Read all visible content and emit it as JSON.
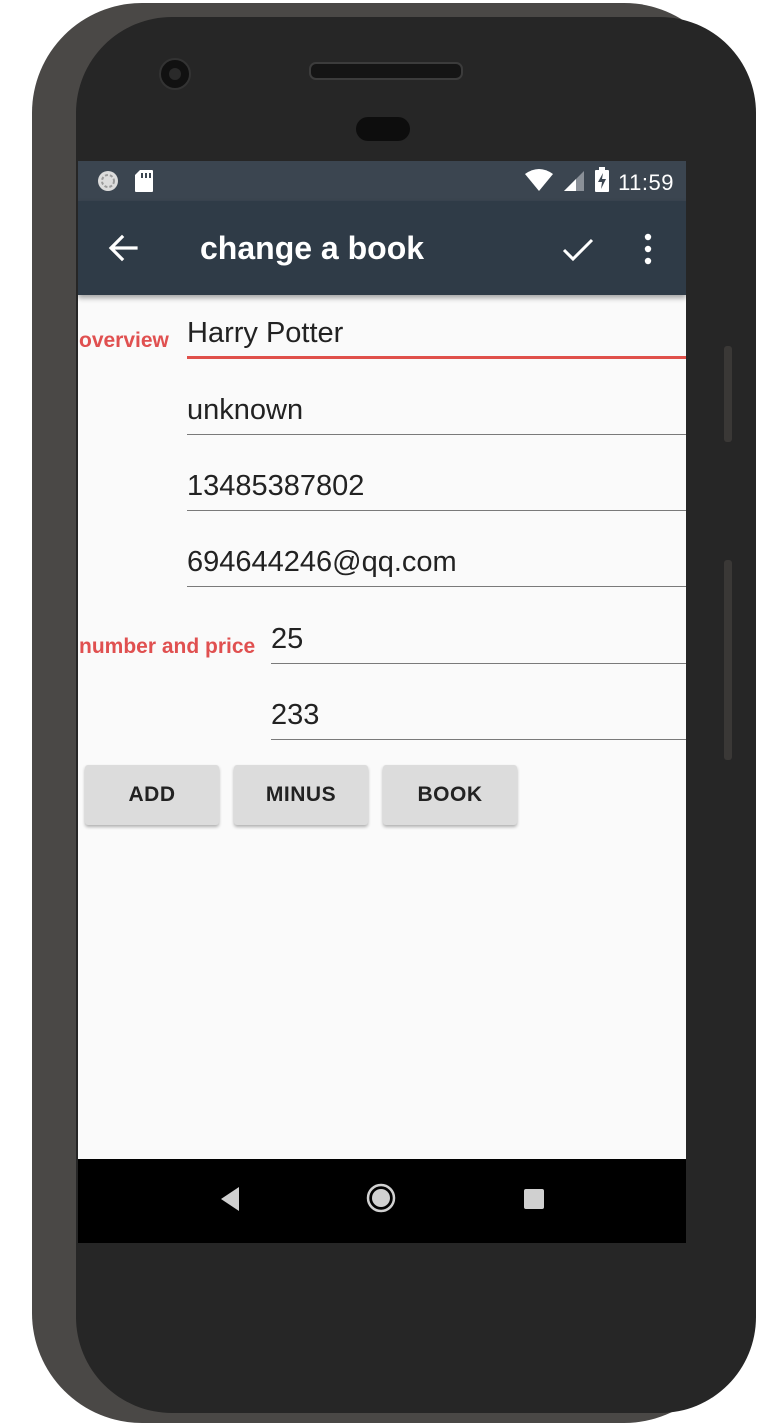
{
  "statusbar": {
    "time": "11:59",
    "icons": [
      "sync-icon",
      "sd-card-icon",
      "wifi-icon",
      "cell-signal-icon",
      "battery-charging-icon"
    ]
  },
  "toolbar": {
    "title": "change a book",
    "back_icon": "arrow-back-icon",
    "confirm_icon": "check-icon",
    "menu_icon": "more-vert-icon"
  },
  "form": {
    "overview_label": "overview",
    "title_value": "Harry Potter",
    "author_value": "unknown",
    "phone_value": "13485387802",
    "email_value": "694644246@qq.com",
    "number_price_label": "number and price",
    "number_value": "25",
    "price_value": "233"
  },
  "buttons": {
    "add": "ADD",
    "minus": "MINUS",
    "book": "BOOK"
  },
  "colors": {
    "accent": "#e05050",
    "toolbar": "#2f3b47",
    "statusbar": "#3b4550"
  }
}
